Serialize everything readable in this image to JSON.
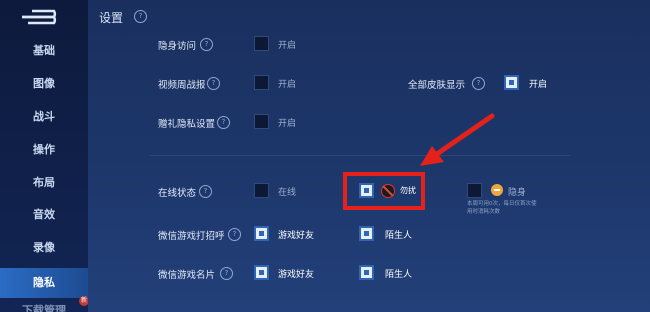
{
  "sidebar": {
    "items": [
      {
        "label": "基础"
      },
      {
        "label": "图像"
      },
      {
        "label": "战斗"
      },
      {
        "label": "操作"
      },
      {
        "label": "布局"
      },
      {
        "label": "音效"
      },
      {
        "label": "录像"
      },
      {
        "label": "隐私"
      },
      {
        "label": "下载管理"
      }
    ],
    "active": "隐私",
    "new_badge": "新"
  },
  "header": {
    "title": "设置",
    "help": "?"
  },
  "privacy": {
    "hidden_access": {
      "label": "隐身访问",
      "option": "开启",
      "checked": false
    },
    "video_report": {
      "label": "视频周战报",
      "option": "开启",
      "checked": false
    },
    "all_skins": {
      "label": "全部皮肤显示",
      "option": "开启",
      "checked": true
    },
    "gift_privacy": {
      "label": "赠礼隐私设置",
      "option": "开启",
      "checked": false
    },
    "online_status": {
      "label": "在线状态",
      "options": [
        {
          "label": "在线",
          "checked": false
        },
        {
          "label": "勿扰",
          "checked": true,
          "icon": "no-entry-icon"
        },
        {
          "label": "隐身",
          "checked": false,
          "icon": "stealth-icon"
        }
      ],
      "note_line1": "本周可用0次，每日仅首次使",
      "note_line2": "用时消耗次数"
    },
    "wechat_greet": {
      "label": "微信游戏打招呼",
      "options": [
        {
          "label": "游戏好友",
          "checked": true
        },
        {
          "label": "陌生人",
          "checked": true
        }
      ]
    },
    "wechat_card": {
      "label": "微信游戏名片",
      "options": [
        {
          "label": "游戏好友",
          "checked": true
        },
        {
          "label": "陌生人",
          "checked": true
        }
      ]
    }
  },
  "colors": {
    "highlight": "#e4211b",
    "accent": "#2d66b6"
  }
}
